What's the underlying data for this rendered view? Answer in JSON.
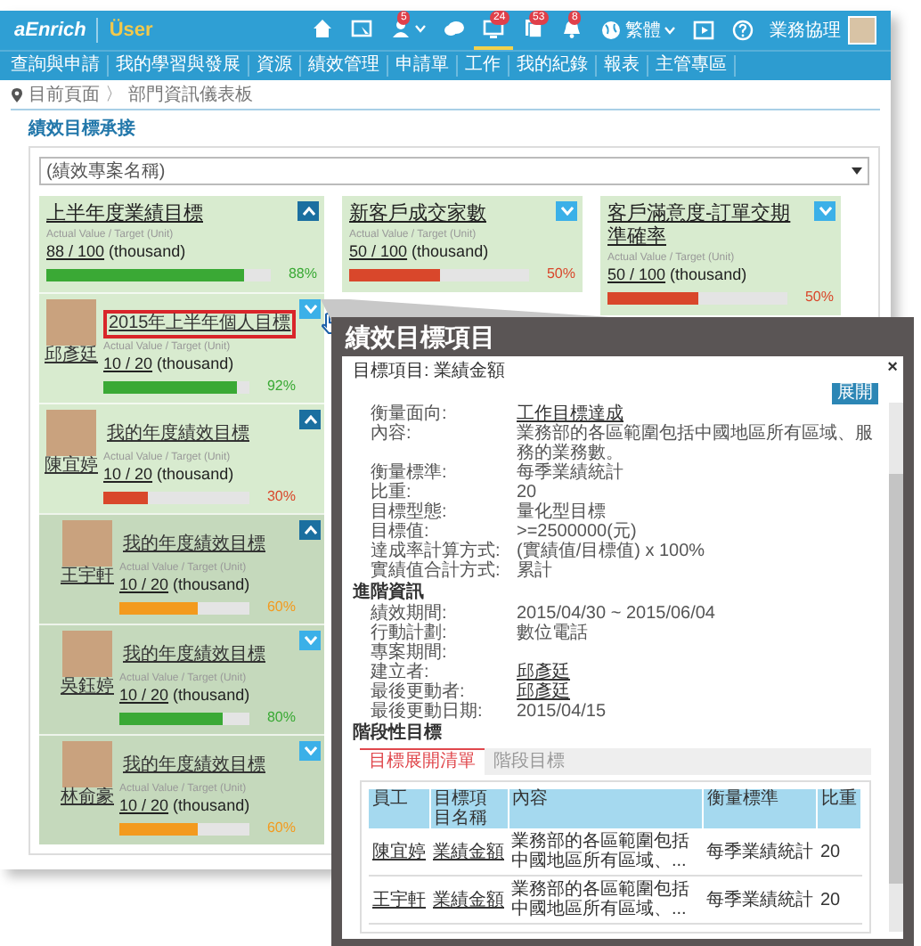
{
  "header": {
    "logo": "aEnrich",
    "app_name": "Üser",
    "icons": [
      {
        "kind": "home",
        "selected": false,
        "dropdown": false
      },
      {
        "kind": "screen",
        "selected": false,
        "dropdown": false
      },
      {
        "kind": "person",
        "badge": "5",
        "selected": false,
        "dropdown": true
      },
      {
        "kind": "chat",
        "selected": false,
        "dropdown": false
      },
      {
        "kind": "monitor",
        "badge": "24",
        "selected": true,
        "dropdown": false
      },
      {
        "kind": "document",
        "badge": "53",
        "selected": false,
        "dropdown": false
      },
      {
        "kind": "bell",
        "badge": "8",
        "selected": false,
        "dropdown": false
      }
    ],
    "language": "繁體",
    "tools": [
      {
        "kind": "play"
      },
      {
        "kind": "help"
      }
    ],
    "user_name": "業務協理"
  },
  "nav": [
    {
      "label": "查詢與申請"
    },
    {
      "label": "我的學習與發展"
    },
    {
      "label": "資源"
    },
    {
      "label": "績效管理"
    },
    {
      "label": "申請單"
    },
    {
      "label": "工作"
    },
    {
      "label": "我的紀錄"
    },
    {
      "label": "報表"
    },
    {
      "label": "主管專區"
    }
  ],
  "breadcrumb": {
    "items": [
      "目前頁面",
      "部門資訊儀表板"
    ],
    "separator": "〉"
  },
  "panel": {
    "title": "績效目標承接",
    "select": {
      "value": "(績效專案名稱)"
    },
    "goals": [
      {
        "title": "上半年度業績目標",
        "subtitle": "Actual Value / Target (Unit)",
        "value": "88 / 100",
        "unit": "(thousand)",
        "level": 0.88,
        "percent": "88%",
        "color": "#3aa935",
        "expanded": true,
        "people": [
          {
            "name": "邱彥廷",
            "title": "2015年上半年個人目標",
            "subtitle": "Actual Value / Target (Unit)",
            "value": "10 / 20",
            "unit": "(thousand)",
            "level": 0.92,
            "percent": "92%",
            "color": "#3aa935",
            "expanded": false,
            "highlighted": true
          },
          {
            "name": "陳宜婷",
            "title": "我的年度績效目標",
            "subtitle": "Actual Value / Target (Unit)",
            "value": "10 / 20",
            "unit": "(thousand)",
            "level": 0.3,
            "percent": "30%",
            "color": "#d9472b",
            "expanded": true,
            "highlighted": false,
            "children": [
              {
                "name": "王宇軒",
                "title": "我的年度績效目標",
                "subtitle": "Actual Value / Target (Unit)",
                "value": "10 / 20",
                "unit": "(thousand)",
                "level": 0.6,
                "percent": "60%",
                "color": "#f39a1e",
                "expanded": true,
                "highlighted": false
              },
              {
                "name": "吳鈺婷",
                "title": "我的年度績效目標",
                "subtitle": "Actual Value / Target (Unit)",
                "value": "10 / 20",
                "unit": "(thousand)",
                "level": 0.8,
                "percent": "80%",
                "color": "#3aa935",
                "expanded": false,
                "highlighted": false
              },
              {
                "name": "林俞豪",
                "title": "我的年度績效目標",
                "subtitle": "Actual Value / Target (Unit)",
                "value": "10 / 20",
                "unit": "(thousand)",
                "level": 0.6,
                "percent": "60%",
                "color": "#f39a1e",
                "expanded": false,
                "highlighted": false
              }
            ]
          }
        ]
      },
      {
        "title": "新客戶成交家數",
        "subtitle": "Actual Value / Target (Unit)",
        "value": "50 / 100",
        "unit": "(thousand)",
        "level": 0.5,
        "percent": "50%",
        "color": "#d9472b",
        "expanded": false
      },
      {
        "title": "客戶滿意度-訂單交期準確率",
        "subtitle": "Actual Value / Target (Unit)",
        "value": "50 / 100",
        "unit": "(thousand)",
        "level": 0.5,
        "percent": "50%",
        "color": "#d9472b",
        "expanded": false
      }
    ]
  },
  "popup": {
    "title": "績效目標項目",
    "header": "目標項目: 業績金額",
    "close": "×",
    "expand_button": "展開",
    "fields": [
      {
        "label": "衡量面向:",
        "value": "工作目標達成",
        "link": true
      },
      {
        "label": "內容:",
        "value": "業務部的各區範圍包括中國地區所有區域、服務的業務數。",
        "link": false
      },
      {
        "label": "衡量標準:",
        "value": "每季業績統計",
        "link": false
      },
      {
        "label": "比重:",
        "value": "20",
        "link": false
      },
      {
        "label": "目標型態:",
        "value": "量化型目標",
        "link": false
      },
      {
        "label": "目標值:",
        "value": ">=2500000(元)",
        "link": false
      },
      {
        "label": "達成率計算方式:",
        "value": "(實績值/目標值) x 100%",
        "link": false
      },
      {
        "label": "實績值合計方式:",
        "value": "累計",
        "link": false
      }
    ],
    "section_title": "進階資訊",
    "advanced_fields": [
      {
        "label": "績效期間:",
        "value": "2015/04/30 ~ 2015/06/04",
        "link": false
      },
      {
        "label": "行動計劃:",
        "value": "數位電話",
        "link": false
      },
      {
        "label": "專案期間:"
      },
      {
        "label": "建立者:",
        "value": "邱彥廷",
        "link": true
      },
      {
        "label": "最後更動者:",
        "value": "邱彥廷",
        "link": true
      },
      {
        "label": "最後更動日期:",
        "value": "2015/04/15",
        "link": false
      }
    ],
    "stage_title": "階段性目標",
    "tabs": [
      {
        "label": "目標展開清單",
        "selected": true
      },
      {
        "label": "階段目標",
        "selected": false
      }
    ],
    "table": {
      "columns": [
        "員工",
        "目標項目名稱",
        "內容",
        "衡量標準",
        "比重"
      ],
      "rows": [
        [
          "陳宜婷",
          "業績金額",
          "業務部的各區範圍包括中國地區所有區域、...",
          "每季業績統計",
          "20"
        ],
        [
          "王宇軒",
          "業績金額",
          "業務部的各區範圍包括中國地區所有區域、...",
          "每季業績統計",
          "20"
        ]
      ]
    }
  }
}
